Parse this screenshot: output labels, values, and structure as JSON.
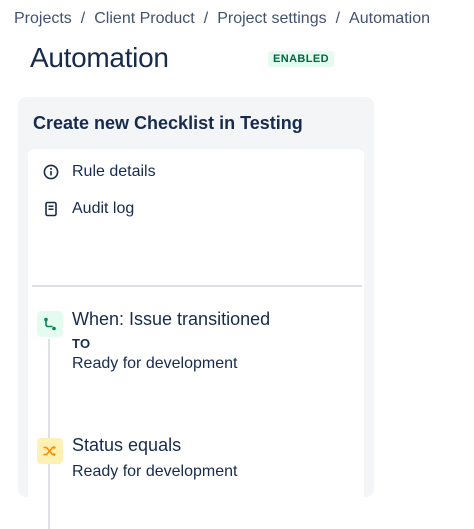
{
  "breadcrumb": {
    "items": [
      "Projects",
      "Client Product",
      "Project settings",
      "Automation"
    ],
    "separator": "/"
  },
  "page": {
    "title": "Automation",
    "status": "ENABLED"
  },
  "rule": {
    "name": "Create new Checklist in Testing",
    "menu": [
      {
        "label": "Rule details",
        "icon": "info-icon"
      },
      {
        "label": "Audit log",
        "icon": "audit-log-icon"
      }
    ],
    "trigger": {
      "title": "When: Issue transitioned",
      "sub_label": "TO",
      "value": "Ready for development",
      "icon": "transition-icon"
    },
    "condition": {
      "title": "Status equals",
      "value": "Ready for development",
      "icon": "shuffle-icon"
    }
  },
  "colors": {
    "text": "#172b4d",
    "panel_bg": "#f4f5f7",
    "enabled_bg": "#e3fcef",
    "enabled_text": "#006644",
    "trigger_icon": "#00875a",
    "condition_bg": "#fff0b3",
    "condition_icon": "#ff8b00"
  }
}
